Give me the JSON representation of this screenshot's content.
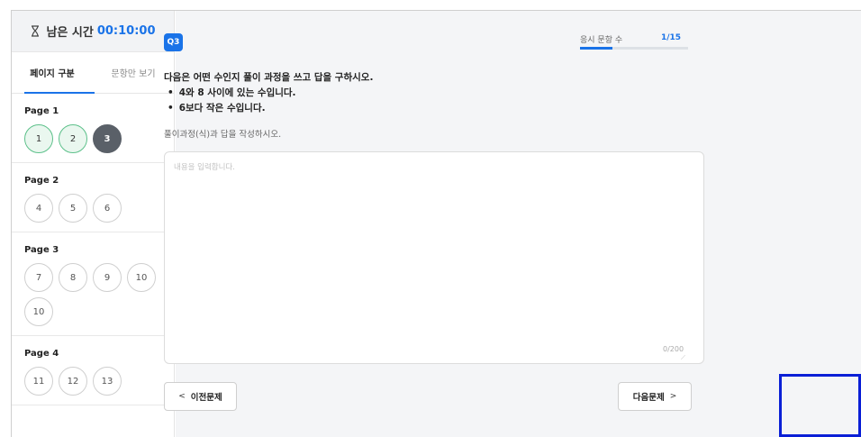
{
  "sidebar": {
    "timer_label": "남은 시간",
    "timer_value": "00:10:00",
    "tabs": [
      {
        "label": "페이지 구분"
      },
      {
        "label": "문항만 보기"
      }
    ],
    "pages": [
      {
        "label": "Page 1",
        "items": [
          {
            "num": "1",
            "state": "done"
          },
          {
            "num": "2",
            "state": "done"
          },
          {
            "num": "3",
            "state": "current"
          }
        ]
      },
      {
        "label": "Page 2",
        "items": [
          {
            "num": "4",
            "state": "todo"
          },
          {
            "num": "5",
            "state": "todo"
          },
          {
            "num": "6",
            "state": "todo"
          }
        ]
      },
      {
        "label": "Page 3",
        "items": [
          {
            "num": "7",
            "state": "todo"
          },
          {
            "num": "8",
            "state": "todo"
          },
          {
            "num": "9",
            "state": "todo"
          },
          {
            "num": "10",
            "state": "todo"
          },
          {
            "num": "10",
            "state": "todo"
          }
        ]
      },
      {
        "label": "Page 4",
        "items": [
          {
            "num": "11",
            "state": "todo"
          },
          {
            "num": "12",
            "state": "todo"
          },
          {
            "num": "13",
            "state": "todo"
          }
        ]
      }
    ]
  },
  "question": {
    "badge": "Q3",
    "progress_label": "응시 문항 수",
    "progress_count": "1/15",
    "progress_fraction": 0.3,
    "title": "다음은 어떤 수인지 풀이 과정을 쓰고 답을 구하시오.",
    "conditions": [
      "4와 8 사이에 있는 수입니다.",
      "6보다 작은 수입니다."
    ],
    "instruction": "풀이과정(식)과 답을 작성하시오.",
    "answer_placeholder": "내용을 입력합니다.",
    "answer_value": "",
    "char_count": "0/200"
  },
  "nav": {
    "prev_label": "이전문제",
    "next_label": "다음문제"
  },
  "colors": {
    "accent": "#1a73e8",
    "done_border": "#5cc08a",
    "current_fill": "#5a6068",
    "highlight": "#0a1fd6"
  }
}
